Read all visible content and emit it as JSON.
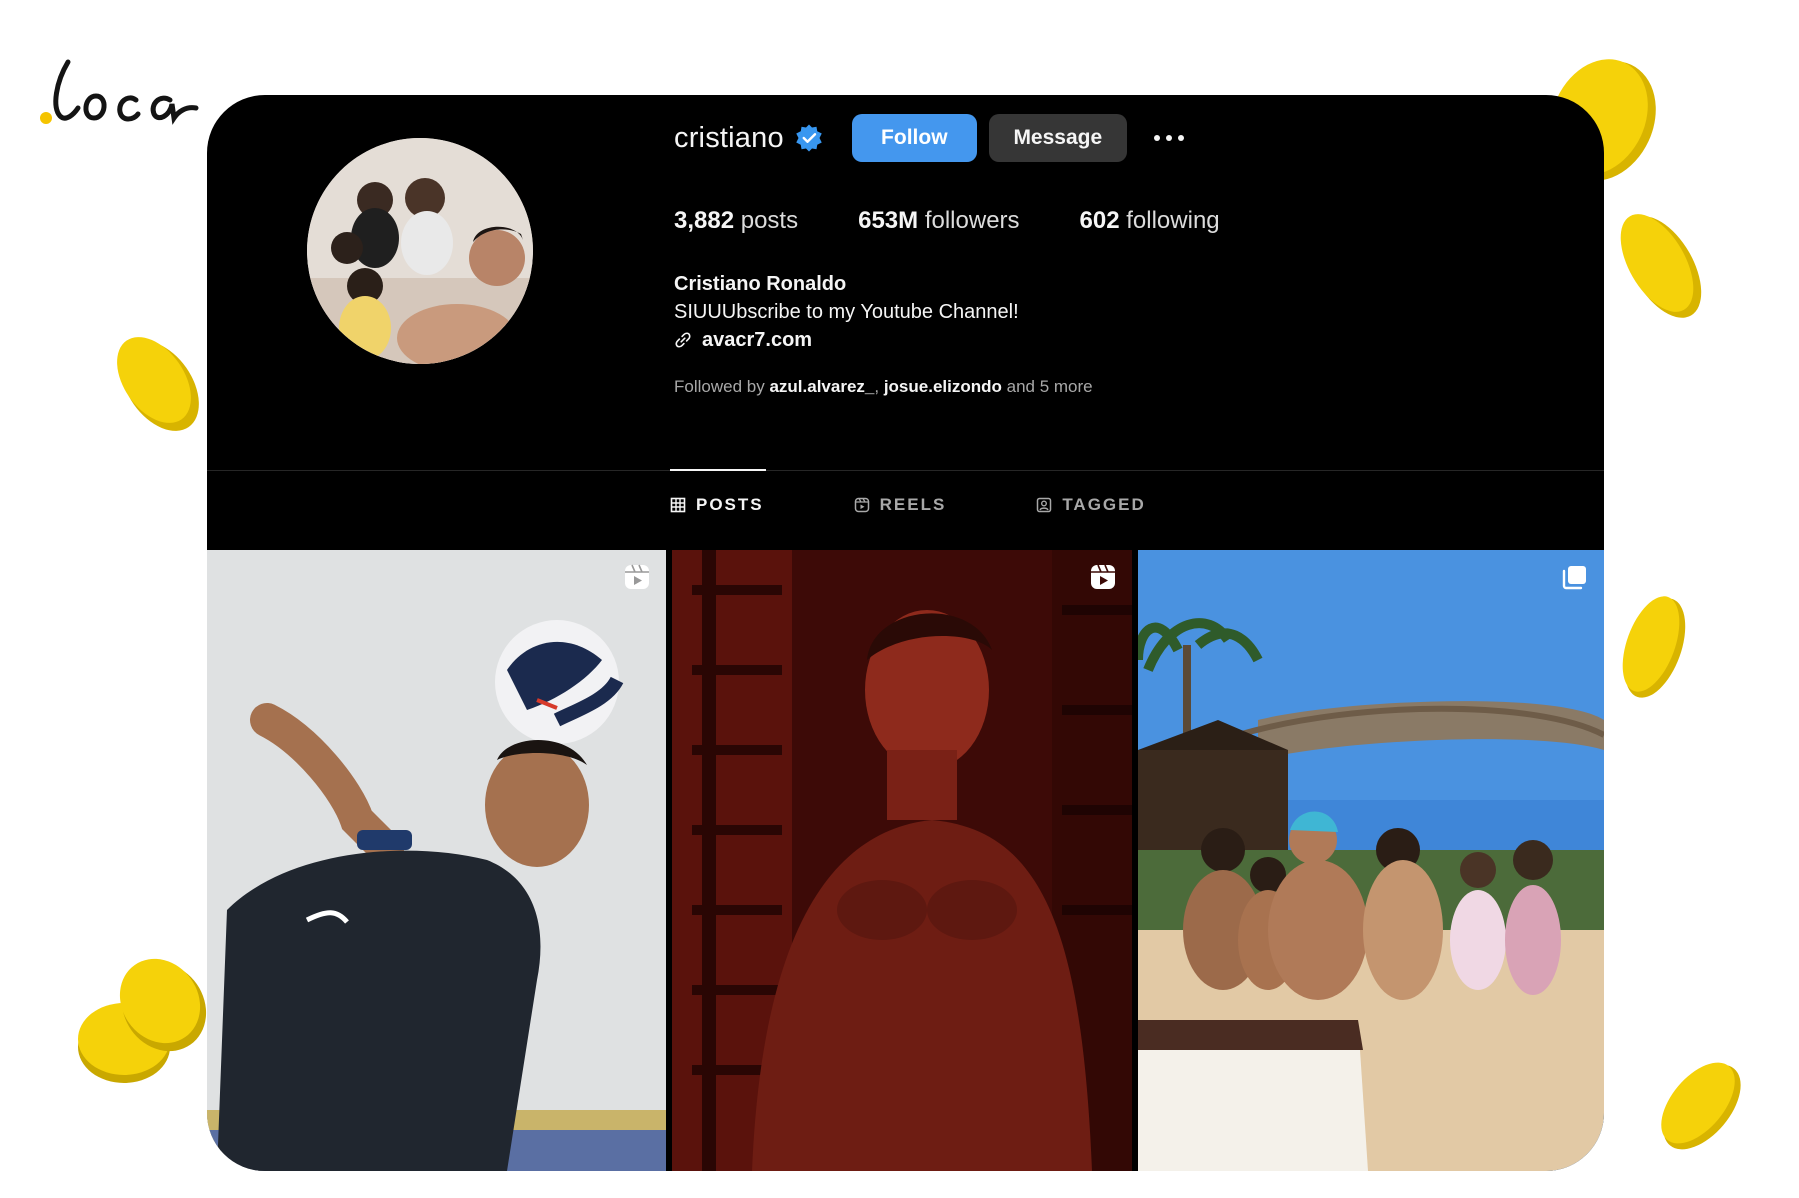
{
  "brand": {
    "logo_text": "loca"
  },
  "profile": {
    "username": "cristiano",
    "follow_label": "Follow",
    "message_label": "Message",
    "stats": [
      {
        "value": "3,882",
        "label": "posts"
      },
      {
        "value": "653M",
        "label": "followers"
      },
      {
        "value": "602",
        "label": "following"
      }
    ],
    "full_name": "Cristiano Ronaldo",
    "bio": "SIUUUbscribe to my Youtube Channel!",
    "link": "avacr7.com",
    "followed_by": {
      "prefix": "Followed by",
      "user1": "azul.alvarez_",
      "separator": ",",
      "user2": "josue.elizondo",
      "suffix": "and 5 more"
    }
  },
  "tabs": [
    {
      "label": "POSTS",
      "icon": "grid-icon",
      "active": true
    },
    {
      "label": "REELS",
      "icon": "reels-icon",
      "active": false
    },
    {
      "label": "TAGGED",
      "icon": "tagged-icon",
      "active": false
    }
  ],
  "posts": [
    {
      "type": "reel",
      "icon": "reel-icon"
    },
    {
      "type": "reel",
      "icon": "reel-icon"
    },
    {
      "type": "carousel",
      "icon": "carousel-icon"
    }
  ],
  "colors": {
    "background": "#000000",
    "follow_button": "#4497ee",
    "message_button": "#363636",
    "verified_badge": "#3897f0",
    "coin": "#f5d20a"
  }
}
